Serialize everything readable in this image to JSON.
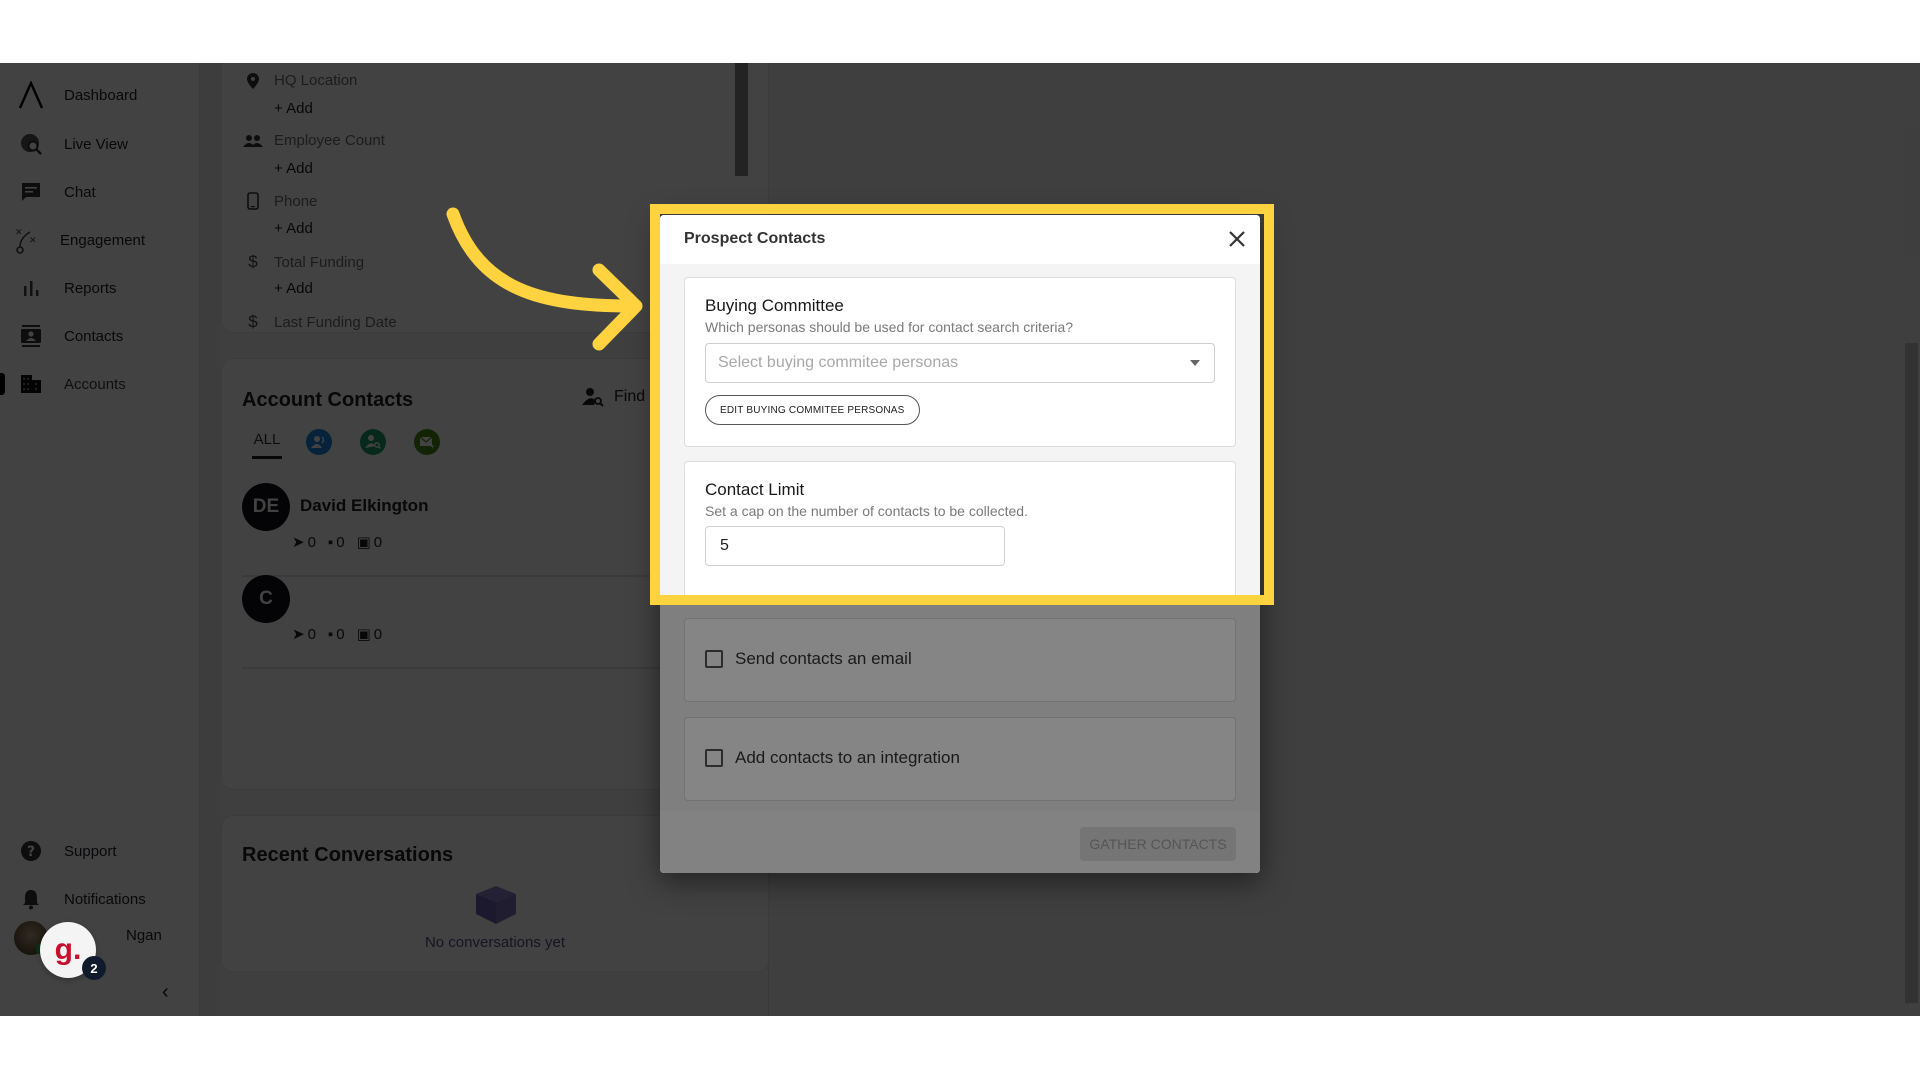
{
  "sidebar": {
    "items": [
      {
        "label": "Dashboard",
        "icon": "logo-caret-icon"
      },
      {
        "label": "Live View",
        "icon": "globe-search-icon"
      },
      {
        "label": "Chat",
        "icon": "chat-icon"
      },
      {
        "label": "Engagement",
        "icon": "strategy-icon"
      },
      {
        "label": "Reports",
        "icon": "bar-chart-icon"
      },
      {
        "label": "Contacts",
        "icon": "contact-card-icon"
      },
      {
        "label": "Accounts",
        "icon": "building-icon",
        "active": true
      }
    ],
    "bottom_items": [
      {
        "label": "Support",
        "icon": "help-icon"
      },
      {
        "label": "Notifications",
        "icon": "bell-icon"
      }
    ],
    "user_name": "Ngan",
    "widget_letter": "g.",
    "widget_badge": "2",
    "collapse_glyph": "‹"
  },
  "account_fields": [
    {
      "label": "HQ Location",
      "icon": "location-pin-icon",
      "action": "+ Add"
    },
    {
      "label": "Employee Count",
      "icon": "people-icon",
      "action": "+ Add"
    },
    {
      "label": "Phone",
      "icon": "phone-icon",
      "action": "+ Add"
    },
    {
      "label": "Total Funding",
      "icon": "dollar-icon",
      "action": "+ Add"
    },
    {
      "label": "Last Funding Date",
      "icon": "dollar-icon"
    }
  ],
  "account_contacts": {
    "title": "Account Contacts",
    "find_label": "Find m",
    "tab_all": "ALL",
    "contacts": [
      {
        "initials": "DE",
        "name": "David Elkington",
        "sent": "0",
        "messages": "0",
        "meetings": "0"
      },
      {
        "initials": "C",
        "name": "",
        "sent": "0",
        "messages": "0",
        "meetings": "0"
      }
    ]
  },
  "recent_conversations": {
    "title": "Recent Conversations",
    "empty_text": "No conversations yet"
  },
  "modal": {
    "title": "Prospect Contacts",
    "buying_committee": {
      "title": "Buying Committee",
      "subtitle": "Which personas should be used for contact search criteria?",
      "select_placeholder": "Select buying commitee personas",
      "edit_button": "EDIT BUYING COMMITEE PERSONAS"
    },
    "contact_limit": {
      "title": "Contact Limit",
      "subtitle": "Set a cap on the number of contacts to be collected.",
      "value": "5"
    },
    "send_email_label": "Send contacts an email",
    "send_email_checked": false,
    "integration_label": "Add contacts to an integration",
    "integration_checked": false,
    "gather_button": "GATHER CONTACTS"
  },
  "colors": {
    "highlight": "#ffd23f",
    "tab_blue": "#1e88e5",
    "tab_green": "#1b9e6b",
    "tab_olive": "#4c8a1a"
  }
}
